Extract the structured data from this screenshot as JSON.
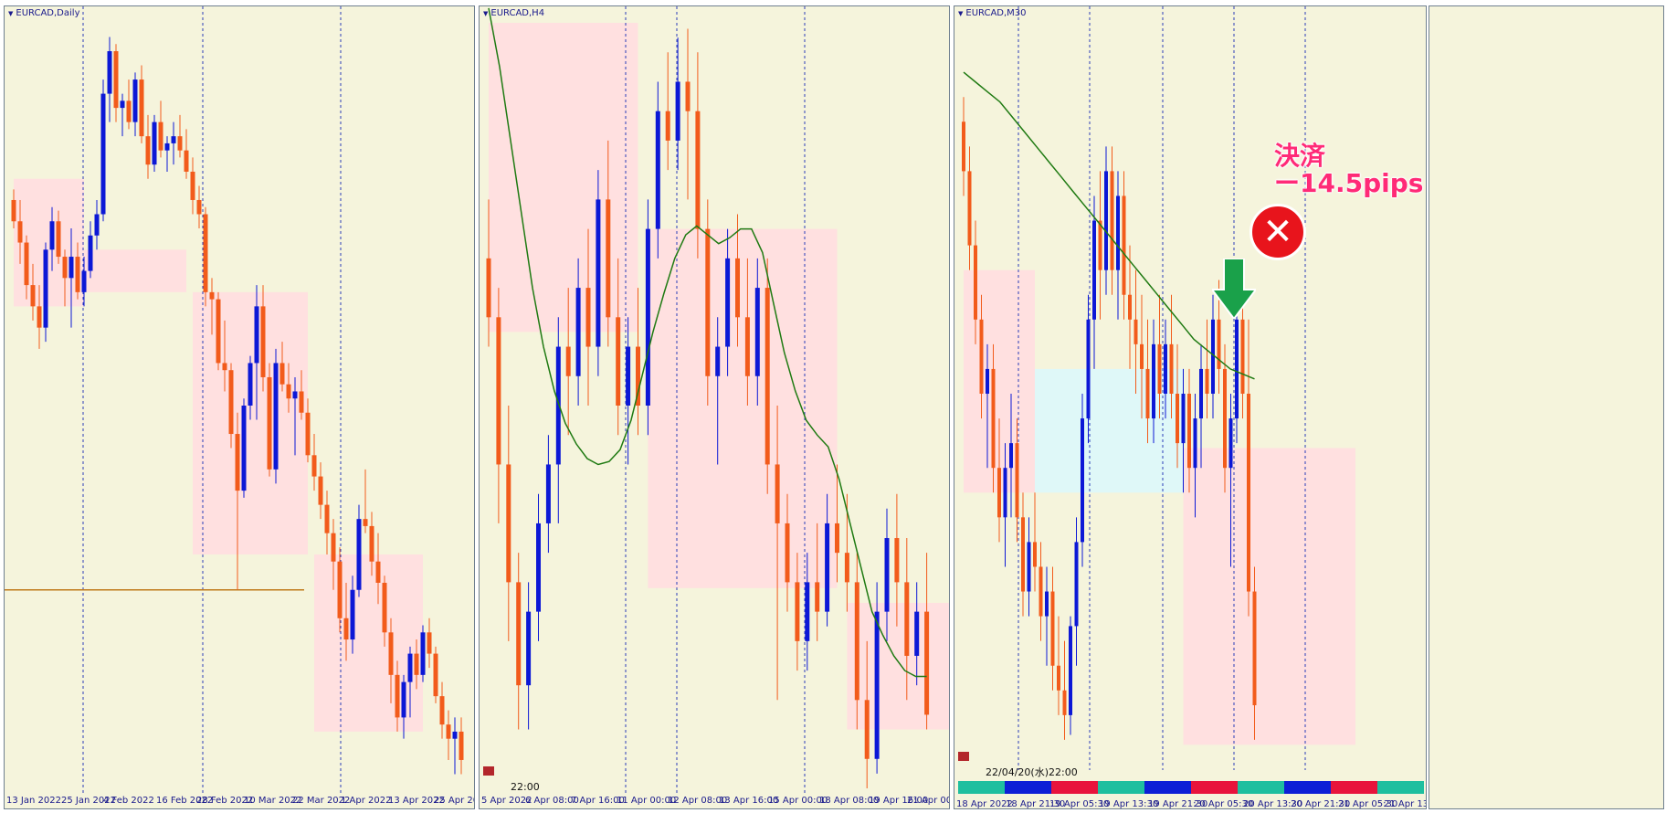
{
  "chart_data": [
    {
      "type": "candlestick",
      "title": "EURCAD,Daily",
      "x_labels": [
        "13 Jan 2022",
        "25 Jan 2022",
        "4 Feb 2022",
        "16 Feb 2022",
        "28 Feb 2022",
        "10 Mar 2022",
        "22 Mar 2022",
        "1 Apr 2022",
        "13 Apr 2022",
        "25 Apr 2022"
      ],
      "ylim": [
        1.34,
        1.448
      ],
      "horizontal_line": 1.368,
      "zones": [
        {
          "x0": 0,
          "x1": 11,
          "y0": 1.426,
          "y1": 1.408,
          "color": "#ffe0e0"
        },
        {
          "x0": 11,
          "x1": 27,
          "y0": 1.416,
          "y1": 1.41,
          "color": "#ffe0e0"
        },
        {
          "x0": 28,
          "x1": 46,
          "y0": 1.41,
          "y1": 1.373,
          "color": "#ffe0e0"
        },
        {
          "x0": 47,
          "x1": 64,
          "y0": 1.373,
          "y1": 1.348,
          "color": "#ffe0e0"
        }
      ],
      "candles": [
        [
          1.423,
          1.4245,
          1.419,
          1.42
        ],
        [
          1.42,
          1.423,
          1.414,
          1.417
        ],
        [
          1.417,
          1.418,
          1.409,
          1.411
        ],
        [
          1.411,
          1.414,
          1.406,
          1.408
        ],
        [
          1.408,
          1.411,
          1.402,
          1.405
        ],
        [
          1.405,
          1.417,
          1.403,
          1.416
        ],
        [
          1.416,
          1.422,
          1.413,
          1.42
        ],
        [
          1.42,
          1.4215,
          1.414,
          1.415
        ],
        [
          1.415,
          1.416,
          1.408,
          1.412
        ],
        [
          1.412,
          1.419,
          1.405,
          1.415
        ],
        [
          1.415,
          1.417,
          1.409,
          1.41
        ],
        [
          1.41,
          1.415,
          1.408,
          1.413
        ],
        [
          1.413,
          1.42,
          1.412,
          1.418
        ],
        [
          1.418,
          1.423,
          1.416,
          1.421
        ],
        [
          1.421,
          1.44,
          1.42,
          1.438
        ],
        [
          1.438,
          1.446,
          1.434,
          1.444
        ],
        [
          1.444,
          1.445,
          1.434,
          1.436
        ],
        [
          1.436,
          1.438,
          1.432,
          1.437
        ],
        [
          1.437,
          1.44,
          1.433,
          1.434
        ],
        [
          1.434,
          1.441,
          1.432,
          1.44
        ],
        [
          1.44,
          1.442,
          1.431,
          1.432
        ],
        [
          1.432,
          1.435,
          1.426,
          1.428
        ],
        [
          1.428,
          1.435,
          1.427,
          1.434
        ],
        [
          1.434,
          1.437,
          1.429,
          1.43
        ],
        [
          1.43,
          1.432,
          1.427,
          1.431
        ],
        [
          1.431,
          1.434,
          1.428,
          1.432
        ],
        [
          1.432,
          1.435,
          1.429,
          1.43
        ],
        [
          1.43,
          1.433,
          1.426,
          1.427
        ],
        [
          1.427,
          1.429,
          1.421,
          1.423
        ],
        [
          1.423,
          1.425,
          1.419,
          1.421
        ],
        [
          1.421,
          1.422,
          1.408,
          1.41
        ],
        [
          1.41,
          1.412,
          1.404,
          1.409
        ],
        [
          1.409,
          1.41,
          1.399,
          1.4
        ],
        [
          1.4,
          1.406,
          1.396,
          1.399
        ],
        [
          1.399,
          1.4,
          1.388,
          1.39
        ],
        [
          1.39,
          1.393,
          1.368,
          1.382
        ],
        [
          1.382,
          1.395,
          1.381,
          1.394
        ],
        [
          1.394,
          1.401,
          1.392,
          1.4
        ],
        [
          1.4,
          1.411,
          1.392,
          1.408
        ],
        [
          1.408,
          1.411,
          1.396,
          1.398
        ],
        [
          1.398,
          1.4,
          1.384,
          1.385
        ],
        [
          1.385,
          1.402,
          1.383,
          1.4
        ],
        [
          1.4,
          1.403,
          1.396,
          1.397
        ],
        [
          1.397,
          1.4,
          1.393,
          1.395
        ],
        [
          1.395,
          1.398,
          1.387,
          1.396
        ],
        [
          1.396,
          1.399,
          1.392,
          1.393
        ],
        [
          1.393,
          1.395,
          1.386,
          1.387
        ],
        [
          1.387,
          1.39,
          1.382,
          1.384
        ],
        [
          1.384,
          1.386,
          1.378,
          1.38
        ],
        [
          1.38,
          1.382,
          1.373,
          1.376
        ],
        [
          1.376,
          1.378,
          1.368,
          1.372
        ],
        [
          1.372,
          1.374,
          1.362,
          1.364
        ],
        [
          1.364,
          1.369,
          1.358,
          1.361
        ],
        [
          1.361,
          1.37,
          1.359,
          1.368
        ],
        [
          1.368,
          1.38,
          1.367,
          1.378
        ],
        [
          1.378,
          1.385,
          1.376,
          1.377
        ],
        [
          1.377,
          1.379,
          1.37,
          1.372
        ],
        [
          1.372,
          1.376,
          1.366,
          1.369
        ],
        [
          1.369,
          1.37,
          1.36,
          1.362
        ],
        [
          1.362,
          1.364,
          1.352,
          1.356
        ],
        [
          1.356,
          1.358,
          1.348,
          1.35
        ],
        [
          1.35,
          1.356,
          1.347,
          1.355
        ],
        [
          1.355,
          1.36,
          1.35,
          1.359
        ],
        [
          1.359,
          1.361,
          1.354,
          1.356
        ],
        [
          1.356,
          1.363,
          1.355,
          1.362
        ],
        [
          1.362,
          1.364,
          1.357,
          1.359
        ],
        [
          1.359,
          1.36,
          1.352,
          1.353
        ],
        [
          1.353,
          1.355,
          1.347,
          1.349
        ],
        [
          1.349,
          1.351,
          1.344,
          1.347
        ],
        [
          1.347,
          1.35,
          1.342,
          1.348
        ],
        [
          1.348,
          1.35,
          1.342,
          1.344
        ]
      ]
    },
    {
      "type": "candlestick",
      "title": "EURCAD,H4",
      "x_labels": [
        "5 Apr 2022",
        "6 Apr 08:00",
        "7 Apr 16:00",
        "11 Apr 00:00",
        "12 Apr 08:00",
        "13 Apr 16:00",
        "15 Apr 00:00",
        "18 Apr 08:00",
        "19 Apr 16:00",
        "21 Apr 00:00"
      ],
      "ylim": [
        1.354,
        1.38
      ],
      "footer_time": "22:00",
      "ma_series": [
        1.3805,
        1.3785,
        1.376,
        1.3735,
        1.371,
        1.369,
        1.3675,
        1.3664,
        1.3657,
        1.3652,
        1.365,
        1.3651,
        1.3655,
        1.3665,
        1.368,
        1.3695,
        1.3708,
        1.372,
        1.3728,
        1.3731,
        1.3728,
        1.3725,
        1.3727,
        1.373,
        1.373,
        1.3722,
        1.3705,
        1.3688,
        1.3675,
        1.3665,
        1.366,
        1.3656,
        1.3645,
        1.363,
        1.3615,
        1.36,
        1.3592,
        1.3585,
        1.358,
        1.3578,
        1.3578
      ],
      "zones": [
        {
          "x0": 0,
          "x1": 15,
          "y0": 1.38,
          "y1": 1.3695,
          "color": "#ffe0e0"
        },
        {
          "x0": 16,
          "x1": 35,
          "y0": 1.373,
          "y1": 1.3608,
          "color": "#ffe0e0"
        },
        {
          "x0": 36,
          "x1": 52,
          "y0": 1.3603,
          "y1": 1.356,
          "color": "#ffe0e0"
        }
      ],
      "candles": [
        [
          1.372,
          1.374,
          1.369,
          1.37
        ],
        [
          1.37,
          1.371,
          1.363,
          1.365
        ],
        [
          1.365,
          1.367,
          1.359,
          1.361
        ],
        [
          1.361,
          1.362,
          1.356,
          1.3575
        ],
        [
          1.3575,
          1.361,
          1.356,
          1.36
        ],
        [
          1.36,
          1.364,
          1.359,
          1.363
        ],
        [
          1.363,
          1.366,
          1.362,
          1.365
        ],
        [
          1.365,
          1.37,
          1.363,
          1.369
        ],
        [
          1.369,
          1.371,
          1.366,
          1.368
        ],
        [
          1.368,
          1.372,
          1.367,
          1.371
        ],
        [
          1.371,
          1.373,
          1.367,
          1.369
        ],
        [
          1.369,
          1.375,
          1.368,
          1.374
        ],
        [
          1.374,
          1.376,
          1.369,
          1.37
        ],
        [
          1.37,
          1.372,
          1.366,
          1.367
        ],
        [
          1.367,
          1.37,
          1.365,
          1.369
        ],
        [
          1.369,
          1.371,
          1.366,
          1.367
        ],
        [
          1.367,
          1.374,
          1.366,
          1.373
        ],
        [
          1.373,
          1.378,
          1.372,
          1.377
        ],
        [
          1.377,
          1.379,
          1.375,
          1.376
        ],
        [
          1.376,
          1.3795,
          1.375,
          1.378
        ],
        [
          1.378,
          1.3798,
          1.374,
          1.377
        ],
        [
          1.377,
          1.379,
          1.372,
          1.373
        ],
        [
          1.373,
          1.374,
          1.367,
          1.368
        ],
        [
          1.368,
          1.37,
          1.365,
          1.369
        ],
        [
          1.369,
          1.373,
          1.368,
          1.372
        ],
        [
          1.372,
          1.3735,
          1.369,
          1.37
        ],
        [
          1.37,
          1.372,
          1.367,
          1.368
        ],
        [
          1.368,
          1.372,
          1.367,
          1.371
        ],
        [
          1.371,
          1.372,
          1.364,
          1.365
        ],
        [
          1.365,
          1.367,
          1.357,
          1.363
        ],
        [
          1.363,
          1.364,
          1.36,
          1.361
        ],
        [
          1.361,
          1.362,
          1.358,
          1.359
        ],
        [
          1.359,
          1.362,
          1.358,
          1.361
        ],
        [
          1.361,
          1.363,
          1.359,
          1.36
        ],
        [
          1.36,
          1.364,
          1.3595,
          1.363
        ],
        [
          1.363,
          1.365,
          1.361,
          1.362
        ],
        [
          1.362,
          1.364,
          1.36,
          1.361
        ],
        [
          1.361,
          1.362,
          1.356,
          1.357
        ],
        [
          1.357,
          1.359,
          1.354,
          1.355
        ],
        [
          1.355,
          1.361,
          1.3545,
          1.36
        ],
        [
          1.36,
          1.3635,
          1.359,
          1.3625
        ],
        [
          1.3625,
          1.364,
          1.3595,
          1.361
        ],
        [
          1.361,
          1.3625,
          1.357,
          1.3585
        ],
        [
          1.3585,
          1.361,
          1.3575,
          1.36
        ],
        [
          1.36,
          1.362,
          1.356,
          1.3565
        ]
      ]
    },
    {
      "type": "candlestick",
      "title": "EURCAD,M30",
      "x_labels": [
        "18 Apr 2022",
        "18 Apr 21:30",
        "19 Apr 05:30",
        "19 Apr 13:30",
        "19 Apr 21:30",
        "20 Apr 05:30",
        "20 Apr 13:30",
        "20 Apr 21:30",
        "21 Apr 05:30",
        "21 Apr 13:30"
      ],
      "ylim": [
        1.357,
        1.372
      ],
      "footer_time": "22/04/20(水)22:00",
      "annotation": {
        "line1": "決済",
        "line2": "ー14.5pips",
        "color": "#ff2a77"
      },
      "session_bar": [
        "#1fbf9f",
        "#0d1fd6",
        "#e8143c",
        "#1fbf9f",
        "#0d1fd6",
        "#e8143c",
        "#1fbf9f",
        "#0d1fd6",
        "#e8143c",
        "#1fbf9f"
      ],
      "ma_series": [
        1.371,
        1.3708,
        1.3706,
        1.3704,
        1.3701,
        1.3698,
        1.3695,
        1.3692,
        1.3689,
        1.3686,
        1.3683,
        1.368,
        1.3677,
        1.3674,
        1.3671,
        1.3668,
        1.3665,
        1.3662,
        1.3659,
        1.3656,
        1.3654,
        1.3652,
        1.365,
        1.3649,
        1.3648
      ],
      "zones": [
        {
          "x0": 0,
          "x1": 12,
          "y0": 1.367,
          "y1": 1.3625,
          "color": "#ffe0e0"
        },
        {
          "x0": 12,
          "x1": 37,
          "y0": 1.365,
          "y1": 1.3625,
          "color": "#dff8f8"
        },
        {
          "x0": 37,
          "x1": 66,
          "y0": 1.3634,
          "y1": 1.3574,
          "color": "#ffe0e0"
        }
      ],
      "candles": [
        [
          1.37,
          1.3705,
          1.3685,
          1.369
        ],
        [
          1.369,
          1.3695,
          1.367,
          1.3675
        ],
        [
          1.3675,
          1.368,
          1.3655,
          1.366
        ],
        [
          1.366,
          1.3665,
          1.364,
          1.3645
        ],
        [
          1.3645,
          1.3655,
          1.363,
          1.365
        ],
        [
          1.365,
          1.3655,
          1.3625,
          1.363
        ],
        [
          1.363,
          1.364,
          1.3615,
          1.362
        ],
        [
          1.362,
          1.3635,
          1.361,
          1.363
        ],
        [
          1.363,
          1.3645,
          1.362,
          1.3635
        ],
        [
          1.3635,
          1.364,
          1.3615,
          1.362
        ],
        [
          1.362,
          1.3625,
          1.36,
          1.3605
        ],
        [
          1.3605,
          1.362,
          1.36,
          1.3615
        ],
        [
          1.3615,
          1.3625,
          1.3605,
          1.361
        ],
        [
          1.361,
          1.3615,
          1.3595,
          1.36
        ],
        [
          1.36,
          1.361,
          1.359,
          1.3605
        ],
        [
          1.3605,
          1.361,
          1.3585,
          1.359
        ],
        [
          1.359,
          1.36,
          1.358,
          1.3585
        ],
        [
          1.3585,
          1.3595,
          1.3575,
          1.358
        ],
        [
          1.358,
          1.36,
          1.3576,
          1.3598
        ],
        [
          1.3598,
          1.362,
          1.359,
          1.3615
        ],
        [
          1.3615,
          1.3645,
          1.361,
          1.364
        ],
        [
          1.364,
          1.3665,
          1.3635,
          1.366
        ],
        [
          1.366,
          1.3685,
          1.365,
          1.368
        ],
        [
          1.368,
          1.369,
          1.366,
          1.367
        ],
        [
          1.367,
          1.3695,
          1.3665,
          1.369
        ],
        [
          1.369,
          1.3695,
          1.3665,
          1.367
        ],
        [
          1.367,
          1.369,
          1.366,
          1.3685
        ],
        [
          1.3685,
          1.369,
          1.366,
          1.3665
        ],
        [
          1.3665,
          1.3675,
          1.365,
          1.366
        ],
        [
          1.366,
          1.367,
          1.3645,
          1.3655
        ],
        [
          1.3655,
          1.3665,
          1.364,
          1.365
        ],
        [
          1.365,
          1.366,
          1.3635,
          1.364
        ],
        [
          1.364,
          1.366,
          1.3635,
          1.3655
        ],
        [
          1.3655,
          1.3665,
          1.364,
          1.3645
        ],
        [
          1.3645,
          1.366,
          1.364,
          1.3655
        ],
        [
          1.3655,
          1.3665,
          1.364,
          1.3645
        ],
        [
          1.3645,
          1.3655,
          1.363,
          1.3635
        ],
        [
          1.3635,
          1.365,
          1.3625,
          1.3645
        ],
        [
          1.3645,
          1.365,
          1.3625,
          1.363
        ],
        [
          1.363,
          1.3645,
          1.362,
          1.364
        ],
        [
          1.364,
          1.3655,
          1.363,
          1.365
        ],
        [
          1.365,
          1.366,
          1.364,
          1.3645
        ],
        [
          1.3645,
          1.3665,
          1.364,
          1.366
        ],
        [
          1.366,
          1.3668,
          1.3645,
          1.365
        ],
        [
          1.365,
          1.3655,
          1.3625,
          1.363
        ],
        [
          1.363,
          1.3645,
          1.361,
          1.364
        ],
        [
          1.364,
          1.3665,
          1.3635,
          1.366
        ],
        [
          1.366,
          1.367,
          1.364,
          1.3645
        ],
        [
          1.3645,
          1.366,
          1.36,
          1.3605
        ],
        [
          1.3605,
          1.361,
          1.3575,
          1.3582
        ]
      ]
    }
  ]
}
